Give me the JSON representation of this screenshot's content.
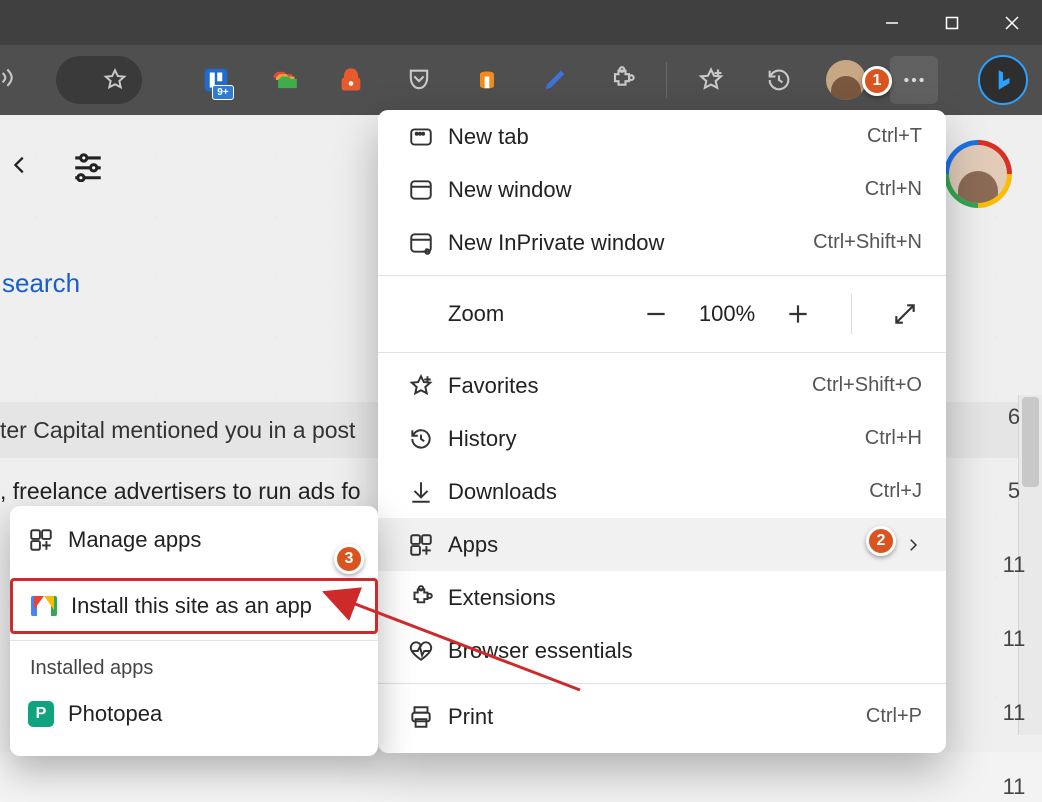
{
  "window_controls": {
    "minimize": "minimize",
    "maximize": "maximize",
    "close": "close"
  },
  "toolbar": {
    "badge_9plus": "9+"
  },
  "page": {
    "search_link": "search",
    "post_bar_text": "ter Capital mentioned you in a post",
    "ads_line_text": ", freelance advertisers to run ads fo"
  },
  "right_numbers": [
    "6",
    "5",
    "11",
    "11",
    "11",
    "11"
  ],
  "menu": {
    "new_tab": {
      "label": "New tab",
      "shortcut": "Ctrl+T"
    },
    "new_window": {
      "label": "New window",
      "shortcut": "Ctrl+N"
    },
    "new_inprivate": {
      "label": "New InPrivate window",
      "shortcut": "Ctrl+Shift+N"
    },
    "zoom": {
      "label": "Zoom",
      "value": "100%"
    },
    "favorites": {
      "label": "Favorites",
      "shortcut": "Ctrl+Shift+O"
    },
    "history": {
      "label": "History",
      "shortcut": "Ctrl+H"
    },
    "downloads": {
      "label": "Downloads",
      "shortcut": "Ctrl+J"
    },
    "apps": {
      "label": "Apps"
    },
    "extensions": {
      "label": "Extensions"
    },
    "browser_essentials": {
      "label": "Browser essentials"
    },
    "print": {
      "label": "Print",
      "shortcut": "Ctrl+P"
    }
  },
  "submenu": {
    "manage": "Manage apps",
    "install": "Install this site as an app",
    "installed_header": "Installed apps",
    "photopea": "Photopea"
  },
  "callouts": {
    "one": "1",
    "two": "2",
    "three": "3"
  }
}
